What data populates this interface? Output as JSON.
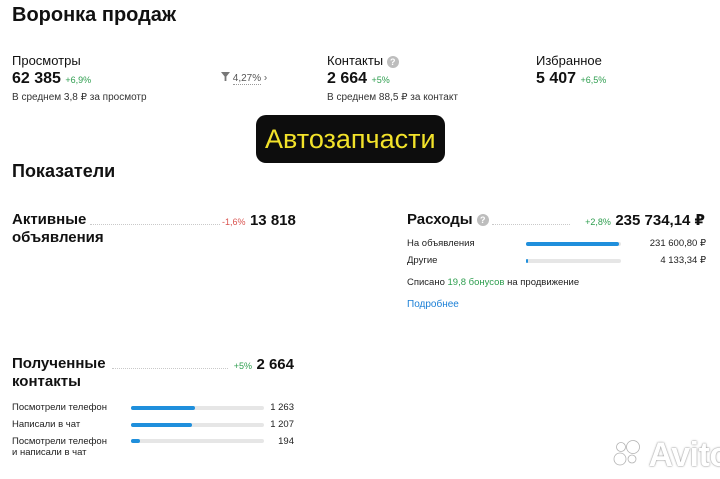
{
  "page_title": "Воронка продаж",
  "funnel": {
    "views": {
      "label": "Просмотры",
      "value": "62 385",
      "change": "+6,9%",
      "note": "В среднем 3,8 ₽ за просмотр"
    },
    "conversion": {
      "value": "4,27%",
      "arrow": "›"
    },
    "contacts": {
      "label": "Контакты",
      "value": "2 664",
      "change": "+5%",
      "note": "В среднем 88,5 ₽ за контакт",
      "help": "?"
    },
    "favorites": {
      "label": "Избранное",
      "value": "5 407",
      "change": "+6,5%"
    }
  },
  "banner": {
    "text": "Автозапчасти"
  },
  "indicators_title": "Показатели",
  "active_ads": {
    "label_line1": "Активные",
    "label_line2": "объявления",
    "change": "-1,6%",
    "value": "13 818"
  },
  "expenses": {
    "label": "Расходы",
    "help": "?",
    "change": "+2,8%",
    "value": "235 734,14 ₽",
    "rows": [
      {
        "label": "На объявления",
        "value": "231 600,80 ₽",
        "fraction": 0.98
      },
      {
        "label": "Другие",
        "value": "4 133,34 ₽",
        "fraction": 0.02
      }
    ],
    "bonus_prefix": "Списано",
    "bonus_amount": "19,8 бонусов",
    "bonus_suffix": "на продвижение",
    "details_link": "Подробнее"
  },
  "received_contacts": {
    "label_line1": "Полученные",
    "label_line2": "контакты",
    "change": "+5%",
    "value": "2 664",
    "rows": [
      {
        "label_line1": "Посмотрели телефон",
        "label_line2": "",
        "value": "1 263",
        "fraction": 0.48
      },
      {
        "label_line1": "Написали в чат",
        "label_line2": "",
        "value": "1 207",
        "fraction": 0.46
      },
      {
        "label_line1": "Посмотрели телефон",
        "label_line2": "и написали в чат",
        "value": "194",
        "fraction": 0.07
      }
    ]
  },
  "watermark": {
    "text": "Avito",
    "icon": "avito-logo-icon"
  },
  "colors": {
    "accent": "#1f8fdc",
    "positive": "#2e9e4f",
    "negative": "#d9534f",
    "banner_bg": "#0d0d0d",
    "banner_text": "#f2e22a",
    "link": "#1a7fd6"
  }
}
